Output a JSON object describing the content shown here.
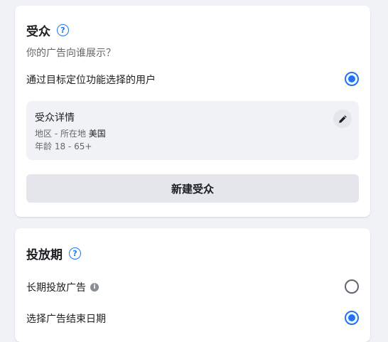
{
  "audience": {
    "title": "受众",
    "help_icon": "question-circle-icon",
    "subtitle": "你的广告向谁展示？",
    "option_label": "通过目标定位功能选择的用户",
    "option_selected": true,
    "details": {
      "title": "受众详情",
      "location_label": "地区 - 所在地",
      "location_value": "美国",
      "age_label": "年龄",
      "age_value": "18 - 65+",
      "edit_icon": "pencil-icon"
    },
    "new_button_label": "新建受众"
  },
  "schedule": {
    "title": "投放期",
    "help_icon": "question-circle-icon",
    "options": [
      {
        "label": "长期投放广告",
        "selected": false,
        "info_icon": "info-circle-icon"
      },
      {
        "label": "选择广告结束日期",
        "selected": true
      }
    ]
  },
  "colors": {
    "accent": "#1877f2",
    "background": "#f0f2f5",
    "card": "#ffffff",
    "secondary_text": "#65676b"
  }
}
